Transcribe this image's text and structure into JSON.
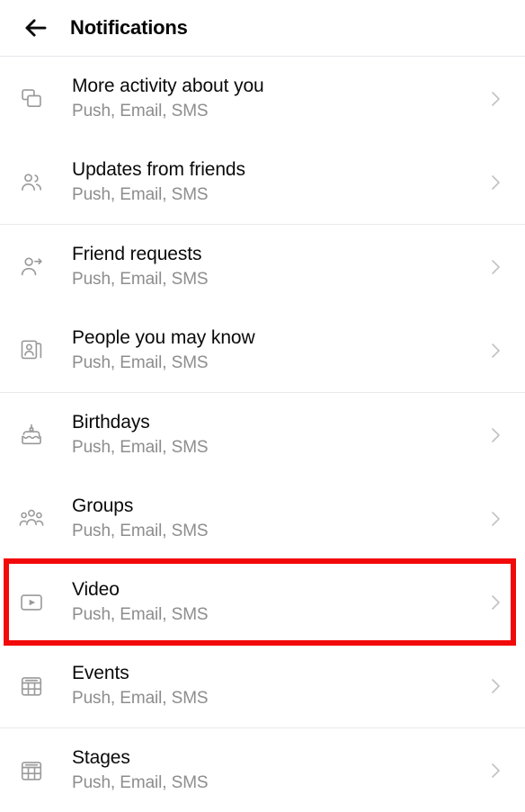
{
  "header": {
    "back_icon": "back-arrow-icon",
    "title": "Notifications"
  },
  "list": {
    "chevron_icon": "chevron-right-icon",
    "items": [
      {
        "id": "more-activity-about-you",
        "icon": "stacked-windows-icon",
        "title": "More activity about you",
        "subtitle": "Push, Email, SMS",
        "divider_after": false,
        "highlighted": false
      },
      {
        "id": "updates-from-friends",
        "icon": "two-people-icon",
        "title": "Updates from friends",
        "subtitle": "Push, Email, SMS",
        "divider_after": true,
        "highlighted": false
      },
      {
        "id": "friend-requests",
        "icon": "person-add-icon",
        "title": "Friend requests",
        "subtitle": "Push, Email, SMS",
        "divider_after": false,
        "highlighted": false
      },
      {
        "id": "people-you-may-know",
        "icon": "profile-cards-icon",
        "title": "People you may know",
        "subtitle": "Push, Email, SMS",
        "divider_after": true,
        "highlighted": false
      },
      {
        "id": "birthdays",
        "icon": "birthday-cake-icon",
        "title": "Birthdays",
        "subtitle": "Push, Email, SMS",
        "divider_after": false,
        "highlighted": false
      },
      {
        "id": "groups",
        "icon": "group-people-icon",
        "title": "Groups",
        "subtitle": "Push, Email, SMS",
        "divider_after": false,
        "highlighted": false
      },
      {
        "id": "video",
        "icon": "video-play-icon",
        "title": "Video",
        "subtitle": "Push, Email, SMS",
        "divider_after": false,
        "highlighted": true
      },
      {
        "id": "events",
        "icon": "calendar-icon",
        "title": "Events",
        "subtitle": "Push, Email, SMS",
        "divider_after": true,
        "highlighted": false
      },
      {
        "id": "stages",
        "icon": "calendar-icon",
        "title": "Stages",
        "subtitle": "Push, Email, SMS",
        "divider_after": false,
        "highlighted": false
      }
    ]
  },
  "annotation": {
    "highlight_color": "#f20a0a",
    "target": "video"
  }
}
